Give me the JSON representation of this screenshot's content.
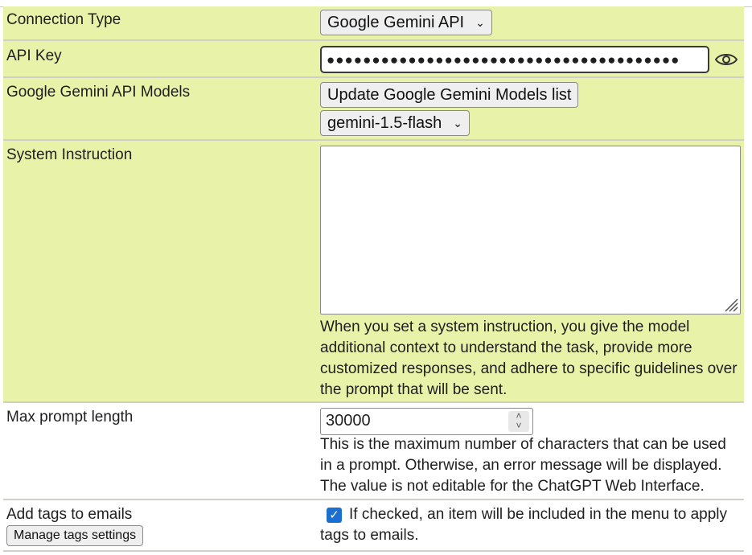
{
  "connection_type": {
    "label": "Connection Type",
    "value": "Google Gemini API"
  },
  "api_key": {
    "label": "API Key",
    "masked_value": "●●●●●●●●●●●●●●●●●●●●●●●●●●●●●●●●●●●●●●●"
  },
  "models": {
    "label": "Google Gemini API Models",
    "update_button": "Update Google Gemini Models list",
    "selected_model": "gemini-1.5-flash"
  },
  "system_instruction": {
    "label": "System Instruction",
    "value": "",
    "help": "When you set a system instruction, you give the model additional context to understand the task, provide more customized responses, and adhere to specific guidelines over the prompt that will be sent."
  },
  "max_prompt": {
    "label": "Max prompt length",
    "value": "30000",
    "help": "This is the maximum number of characters that can be used in a prompt. Otherwise, an error message will be displayed. The value is not editable for the ChatGPT Web Interface."
  },
  "tags": {
    "label": "Add tags to emails",
    "manage_button": "Manage tags settings",
    "checked": true,
    "help": "If checked, an item will be included in the menu to apply tags to emails."
  },
  "colors": {
    "highlight_bg": "#e8f2a8",
    "checkbox": "#1a6fd1"
  }
}
